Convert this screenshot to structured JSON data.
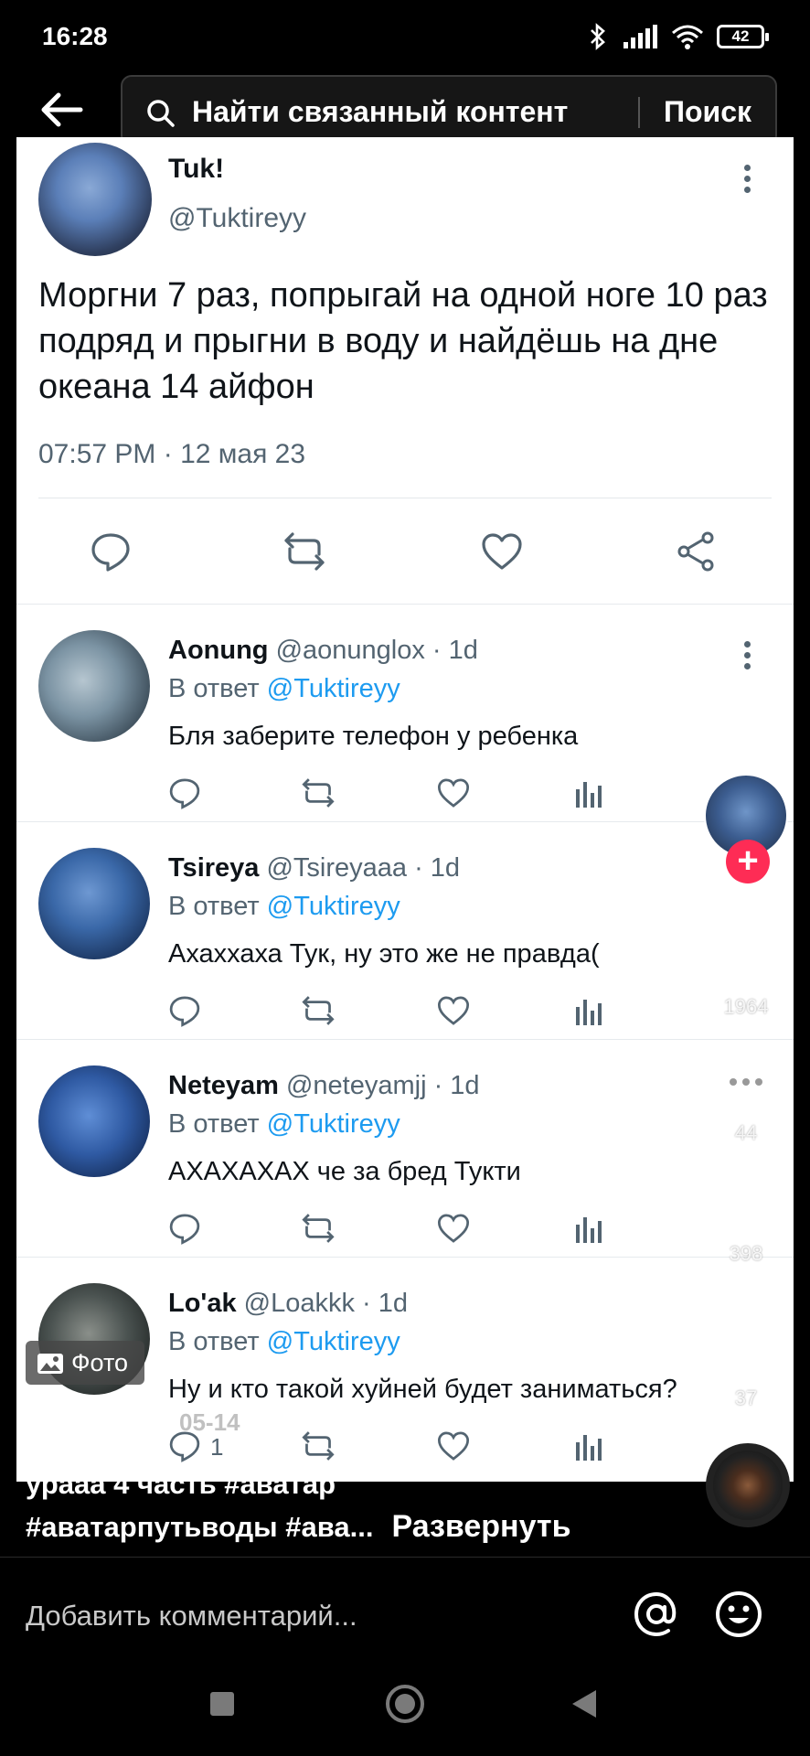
{
  "status_bar": {
    "time": "16:28",
    "battery": "42"
  },
  "search": {
    "placeholder": "Найти связанный контент",
    "button": "Поиск"
  },
  "main_tweet": {
    "name": "Tuk!",
    "handle": "@Tuktireyy",
    "text": "Моргни 7 раз, попрыгай на одной ноге 10 раз подряд и прыгни в воду и найдёшь на дне океана 14 айфон",
    "date": "07:57 PM · 12 мая 23"
  },
  "replies": [
    {
      "name": "Aonung",
      "handle": "@aonunglox · 1d",
      "reply_prefix": "В ответ",
      "mention": "@Tuktireyy",
      "text": "Бля заберите телефон у ребенка",
      "reply_count": ""
    },
    {
      "name": "Tsireya",
      "handle": "@Tsireyaaa · 1d",
      "reply_prefix": "В ответ",
      "mention": "@Tuktireyy",
      "text": "Ахаххаха Тук, ну это же не правда(",
      "reply_count": ""
    },
    {
      "name": "Neteyam",
      "handle": "@neteyamjj · 1d",
      "reply_prefix": "В ответ",
      "mention": "@Tuktireyy",
      "text": "АХАХАХАХ че за бред Тукти",
      "reply_count": ""
    },
    {
      "name": "Lo'ak",
      "handle": "@Loakkk · 1d",
      "reply_prefix": "В ответ",
      "mention": "@Tuktireyy",
      "text": "Ну и кто такой хуйней будет заниматься?",
      "reply_count": "1"
    }
  ],
  "side_actions": {
    "likes": "1964",
    "comments": "44",
    "saves": "398",
    "shares": "37"
  },
  "photo_badge": "Фото",
  "ghost_date": "05-14",
  "caption": {
    "line1": "урааа 4 часть #аватар",
    "line2": "#аватарпутьводы #ава...",
    "expand": "Развернуть"
  },
  "comment_bar": {
    "placeholder": "Добавить комментарий..."
  },
  "colors": {
    "link": "#1d9bf0",
    "follow": "#fe2c55",
    "muted": "#536471"
  }
}
